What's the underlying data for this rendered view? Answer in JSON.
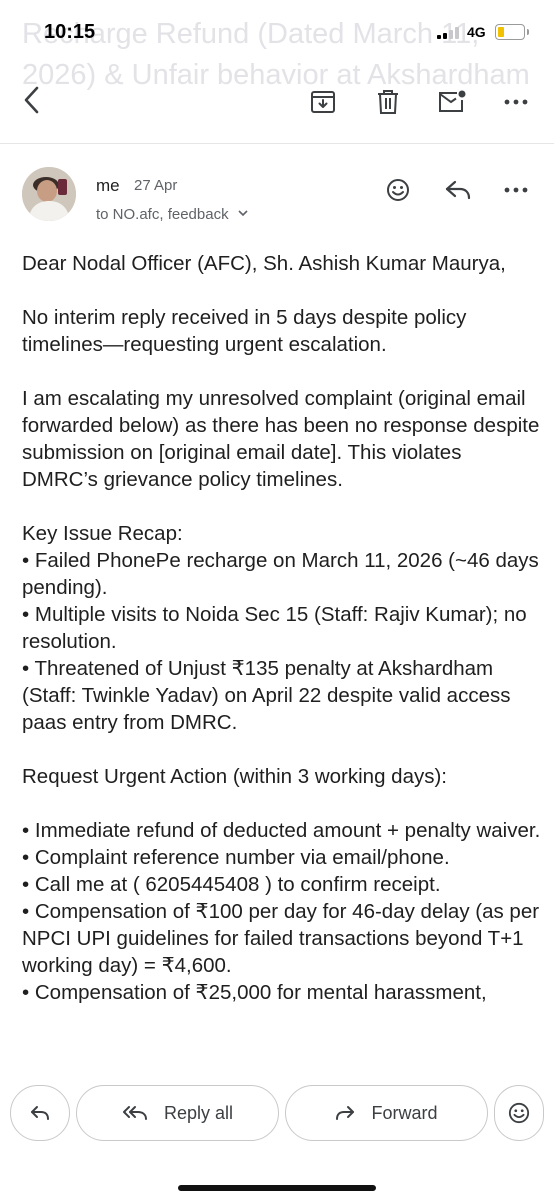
{
  "status_bar": {
    "time": "10:15",
    "network": "4G"
  },
  "subject": "Recharge Refund (Dated March 11, 2026) & Unfair behavior at Akshardham",
  "toolbar": {
    "back_icon": "chevron-left-icon",
    "archive_icon": "archive-icon",
    "delete_icon": "trash-icon",
    "mark_unread_icon": "mail-unread-icon",
    "more_icon": "more-horizontal-icon"
  },
  "message": {
    "sender": "me",
    "date": "27 Apr",
    "recipients": "to NO.afc, feedback",
    "body": [
      "Dear Nodal Officer (AFC), Sh. Ashish Kumar Maurya,",
      "",
      "No interim reply received in 5 days despite policy timelines—requesting urgent escalation.",
      "",
      "I am escalating my unresolved complaint (original email forwarded below) as there has been no response despite submission on [original email date]. This violates DMRC’s grievance policy timelines.",
      "",
      "Key Issue Recap:",
      "• Failed PhonePe recharge on March 11, 2026 (~46 days pending).",
      "• Multiple visits to Noida Sec 15 (Staff: Rajiv Kumar); no resolution.",
      "• Threatened of Unjust ₹135 penalty at Akshardham (Staff: Twinkle Yadav) on April 22 despite valid access paas entry from DMRC.",
      "",
      "Request Urgent Action (within 3 working days):",
      "",
      "• Immediate refund of deducted amount + penalty waiver.",
      "• Complaint reference number via email/phone.",
      "• Call me at ( 6205445408 ) to confirm receipt.",
      "• Compensation of ₹100 per day for 46-day delay (as per NPCI UPI guidelines for failed transactions beyond T+1 working day) = ₹4,600.",
      "• Compensation of ₹25,000 for mental harassment,"
    ]
  },
  "actions": {
    "reply_all": "Reply all",
    "forward": "Forward"
  },
  "colors": {
    "battery": "#f2c200",
    "text": "#1f1f1f",
    "secondary_text": "#5f6368",
    "ghost_subject": "#e3e3e7"
  }
}
